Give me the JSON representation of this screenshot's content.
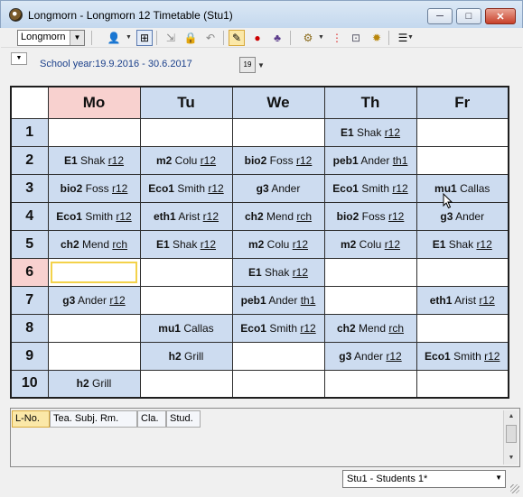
{
  "window": {
    "title": "Longmorn - Longmorn 12  Timetable  (Stu1)",
    "min": "─",
    "max": "□",
    "close": "✕"
  },
  "toolbar": {
    "element_select": "Longmorn",
    "icons": [
      "person-icon",
      "dropdown-icon",
      "grid-add-icon",
      "import-icon",
      "lock-icon",
      "undo-icon",
      "paint-icon",
      "pin-icon",
      "people-icon",
      "gear-icon",
      "traffic-light-icon",
      "zoom-icon",
      "settings-icon",
      "list-icon"
    ]
  },
  "yearbar": {
    "school_year": "School year:19.9.2016 - 30.6.2017",
    "calendar_label": "19"
  },
  "timetable": {
    "days": [
      "Mo",
      "Tu",
      "We",
      "Th",
      "Fr"
    ],
    "selected_day": 0,
    "selected_hour": 5,
    "hours": [
      "1",
      "2",
      "3",
      "4",
      "5",
      "6",
      "7",
      "8",
      "9",
      "10"
    ],
    "rows": [
      [
        null,
        null,
        null,
        {
          "s": "E1",
          "t": "Shak",
          "r": "r12"
        },
        null
      ],
      [
        {
          "s": "E1",
          "t": "Shak",
          "r": "r12"
        },
        {
          "s": "m2",
          "t": "Colu",
          "r": "r12"
        },
        {
          "s": "bio2",
          "t": "Foss",
          "r": "r12"
        },
        {
          "s": "peb1",
          "t": "Ander",
          "r": "th1"
        },
        null
      ],
      [
        {
          "s": "bio2",
          "t": "Foss",
          "r": "r12"
        },
        {
          "s": "Eco1",
          "t": "Smith",
          "r": "r12"
        },
        {
          "s": "g3",
          "t": "Ander",
          "r": ""
        },
        {
          "s": "Eco1",
          "t": "Smith",
          "r": "r12"
        },
        {
          "s": "mu1",
          "t": "Callas",
          "r": ""
        }
      ],
      [
        {
          "s": "Eco1",
          "t": "Smith",
          "r": "r12"
        },
        {
          "s": "eth1",
          "t": "Arist",
          "r": "r12"
        },
        {
          "s": "ch2",
          "t": "Mend",
          "r": "rch"
        },
        {
          "s": "bio2",
          "t": "Foss",
          "r": "r12"
        },
        {
          "s": "g3",
          "t": "Ander",
          "r": ""
        }
      ],
      [
        {
          "s": "ch2",
          "t": "Mend",
          "r": "rch"
        },
        {
          "s": "E1",
          "t": "Shak",
          "r": "r12"
        },
        {
          "s": "m2",
          "t": "Colu",
          "r": "r12"
        },
        {
          "s": "m2",
          "t": "Colu",
          "r": "r12"
        },
        {
          "s": "E1",
          "t": "Shak",
          "r": "r12"
        }
      ],
      [
        null,
        null,
        {
          "s": "E1",
          "t": "Shak",
          "r": "r12"
        },
        null,
        null
      ],
      [
        {
          "s": "g3",
          "t": "Ander",
          "r": "r12"
        },
        null,
        {
          "s": "peb1",
          "t": "Ander",
          "r": "th1"
        },
        null,
        {
          "s": "eth1",
          "t": "Arist",
          "r": "r12"
        }
      ],
      [
        null,
        {
          "s": "mu1",
          "t": "Callas",
          "r": ""
        },
        {
          "s": "Eco1",
          "t": "Smith",
          "r": "r12"
        },
        {
          "s": "ch2",
          "t": "Mend",
          "r": "rch"
        },
        null
      ],
      [
        null,
        {
          "s": "h2",
          "t": "Grill",
          "r": ""
        },
        null,
        {
          "s": "g3",
          "t": "Ander",
          "r": "r12"
        },
        {
          "s": "Eco1",
          "t": "Smith",
          "r": "r12"
        }
      ],
      [
        {
          "s": "h2",
          "t": "Grill",
          "r": ""
        },
        null,
        null,
        null,
        null
      ]
    ]
  },
  "lesson_panel": {
    "columns": [
      "L-No.",
      "Tea. Subj. Rm.",
      "Cla.",
      "Stud."
    ]
  },
  "statusbar": {
    "view_select": "Stu1 - Students 1*"
  }
}
